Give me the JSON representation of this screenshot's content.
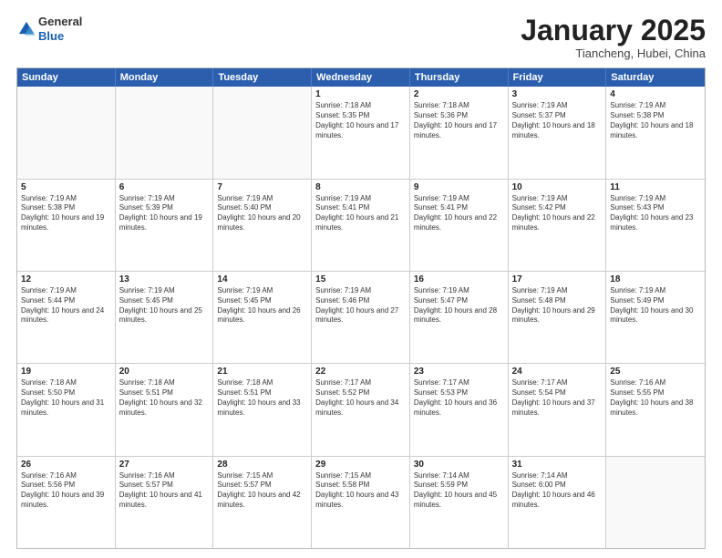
{
  "header": {
    "logo": {
      "general": "General",
      "blue": "Blue"
    },
    "title": "January 2025",
    "subtitle": "Tiancheng, Hubei, China"
  },
  "days": [
    "Sunday",
    "Monday",
    "Tuesday",
    "Wednesday",
    "Thursday",
    "Friday",
    "Saturday"
  ],
  "weeks": [
    [
      {
        "day": "",
        "info": ""
      },
      {
        "day": "",
        "info": ""
      },
      {
        "day": "",
        "info": ""
      },
      {
        "day": "1",
        "info": "Sunrise: 7:18 AM\nSunset: 5:35 PM\nDaylight: 10 hours and 17 minutes."
      },
      {
        "day": "2",
        "info": "Sunrise: 7:18 AM\nSunset: 5:36 PM\nDaylight: 10 hours and 17 minutes."
      },
      {
        "day": "3",
        "info": "Sunrise: 7:19 AM\nSunset: 5:37 PM\nDaylight: 10 hours and 18 minutes."
      },
      {
        "day": "4",
        "info": "Sunrise: 7:19 AM\nSunset: 5:38 PM\nDaylight: 10 hours and 18 minutes."
      }
    ],
    [
      {
        "day": "5",
        "info": "Sunrise: 7:19 AM\nSunset: 5:38 PM\nDaylight: 10 hours and 19 minutes."
      },
      {
        "day": "6",
        "info": "Sunrise: 7:19 AM\nSunset: 5:39 PM\nDaylight: 10 hours and 19 minutes."
      },
      {
        "day": "7",
        "info": "Sunrise: 7:19 AM\nSunset: 5:40 PM\nDaylight: 10 hours and 20 minutes."
      },
      {
        "day": "8",
        "info": "Sunrise: 7:19 AM\nSunset: 5:41 PM\nDaylight: 10 hours and 21 minutes."
      },
      {
        "day": "9",
        "info": "Sunrise: 7:19 AM\nSunset: 5:41 PM\nDaylight: 10 hours and 22 minutes."
      },
      {
        "day": "10",
        "info": "Sunrise: 7:19 AM\nSunset: 5:42 PM\nDaylight: 10 hours and 22 minutes."
      },
      {
        "day": "11",
        "info": "Sunrise: 7:19 AM\nSunset: 5:43 PM\nDaylight: 10 hours and 23 minutes."
      }
    ],
    [
      {
        "day": "12",
        "info": "Sunrise: 7:19 AM\nSunset: 5:44 PM\nDaylight: 10 hours and 24 minutes."
      },
      {
        "day": "13",
        "info": "Sunrise: 7:19 AM\nSunset: 5:45 PM\nDaylight: 10 hours and 25 minutes."
      },
      {
        "day": "14",
        "info": "Sunrise: 7:19 AM\nSunset: 5:45 PM\nDaylight: 10 hours and 26 minutes."
      },
      {
        "day": "15",
        "info": "Sunrise: 7:19 AM\nSunset: 5:46 PM\nDaylight: 10 hours and 27 minutes."
      },
      {
        "day": "16",
        "info": "Sunrise: 7:19 AM\nSunset: 5:47 PM\nDaylight: 10 hours and 28 minutes."
      },
      {
        "day": "17",
        "info": "Sunrise: 7:19 AM\nSunset: 5:48 PM\nDaylight: 10 hours and 29 minutes."
      },
      {
        "day": "18",
        "info": "Sunrise: 7:19 AM\nSunset: 5:49 PM\nDaylight: 10 hours and 30 minutes."
      }
    ],
    [
      {
        "day": "19",
        "info": "Sunrise: 7:18 AM\nSunset: 5:50 PM\nDaylight: 10 hours and 31 minutes."
      },
      {
        "day": "20",
        "info": "Sunrise: 7:18 AM\nSunset: 5:51 PM\nDaylight: 10 hours and 32 minutes."
      },
      {
        "day": "21",
        "info": "Sunrise: 7:18 AM\nSunset: 5:51 PM\nDaylight: 10 hours and 33 minutes."
      },
      {
        "day": "22",
        "info": "Sunrise: 7:17 AM\nSunset: 5:52 PM\nDaylight: 10 hours and 34 minutes."
      },
      {
        "day": "23",
        "info": "Sunrise: 7:17 AM\nSunset: 5:53 PM\nDaylight: 10 hours and 36 minutes."
      },
      {
        "day": "24",
        "info": "Sunrise: 7:17 AM\nSunset: 5:54 PM\nDaylight: 10 hours and 37 minutes."
      },
      {
        "day": "25",
        "info": "Sunrise: 7:16 AM\nSunset: 5:55 PM\nDaylight: 10 hours and 38 minutes."
      }
    ],
    [
      {
        "day": "26",
        "info": "Sunrise: 7:16 AM\nSunset: 5:56 PM\nDaylight: 10 hours and 39 minutes."
      },
      {
        "day": "27",
        "info": "Sunrise: 7:16 AM\nSunset: 5:57 PM\nDaylight: 10 hours and 41 minutes."
      },
      {
        "day": "28",
        "info": "Sunrise: 7:15 AM\nSunset: 5:57 PM\nDaylight: 10 hours and 42 minutes."
      },
      {
        "day": "29",
        "info": "Sunrise: 7:15 AM\nSunset: 5:58 PM\nDaylight: 10 hours and 43 minutes."
      },
      {
        "day": "30",
        "info": "Sunrise: 7:14 AM\nSunset: 5:59 PM\nDaylight: 10 hours and 45 minutes."
      },
      {
        "day": "31",
        "info": "Sunrise: 7:14 AM\nSunset: 6:00 PM\nDaylight: 10 hours and 46 minutes."
      },
      {
        "day": "",
        "info": ""
      }
    ]
  ]
}
